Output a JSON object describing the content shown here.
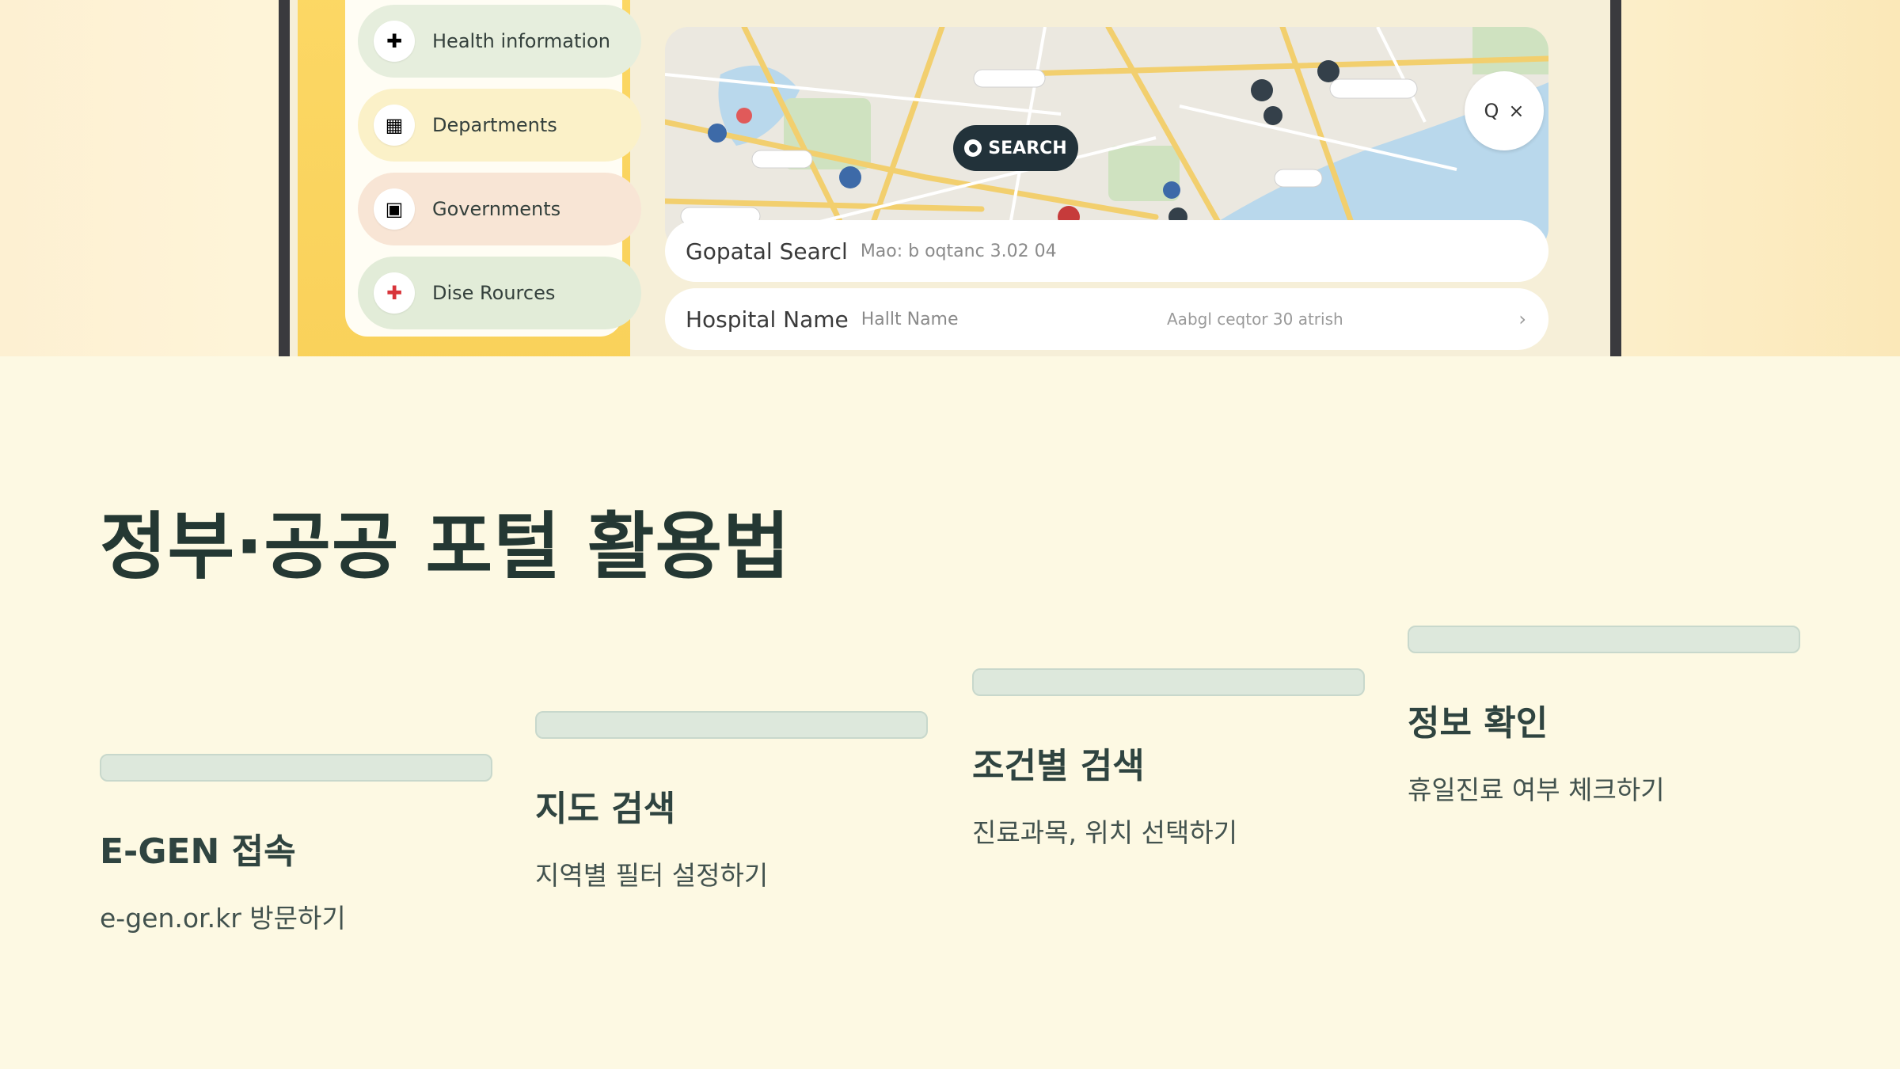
{
  "hero": {
    "side_items": [
      {
        "label": "Health information",
        "icon": "health-icon",
        "bg": "#e6eedd"
      },
      {
        "label": "Departments",
        "icon": "building-icon",
        "bg": "#fbf1c8"
      },
      {
        "label": "Governments",
        "icon": "government-icon",
        "bg": "#f8e5d5"
      },
      {
        "label": "Dise Rources",
        "icon": "first-aid-icon",
        "bg": "#e2ecd8"
      }
    ],
    "map_search_label": "SEARCH",
    "map_tools": {
      "search_icon": "Q",
      "close_icon": "×"
    },
    "search_row": {
      "main": "Gopatal Searcl",
      "sub": "Mao: b oqtanc 3.02 04"
    },
    "hospital_row": {
      "main": "Hospital Name",
      "sub": "Hallt Name",
      "meta": "Aabgl ceqtor 30 atrish",
      "chevron": "›"
    }
  },
  "page": {
    "title": "정부·공공 포털 활용법"
  },
  "steps": [
    {
      "title": "E-GEN 접속",
      "desc": "e-gen.or.kr 방문하기"
    },
    {
      "title": "지도 검색",
      "desc": "지역별 필터 설정하기"
    },
    {
      "title": "조건별 검색",
      "desc": "진료과목, 위치 선택하기"
    },
    {
      "title": "정보 확인",
      "desc": "휴일진료 여부 체크하기"
    }
  ],
  "colors": {
    "background": "#fdf9e3",
    "title": "#243833",
    "step_bar": "#dde8dc",
    "accent_yellow": "#fcd865"
  }
}
